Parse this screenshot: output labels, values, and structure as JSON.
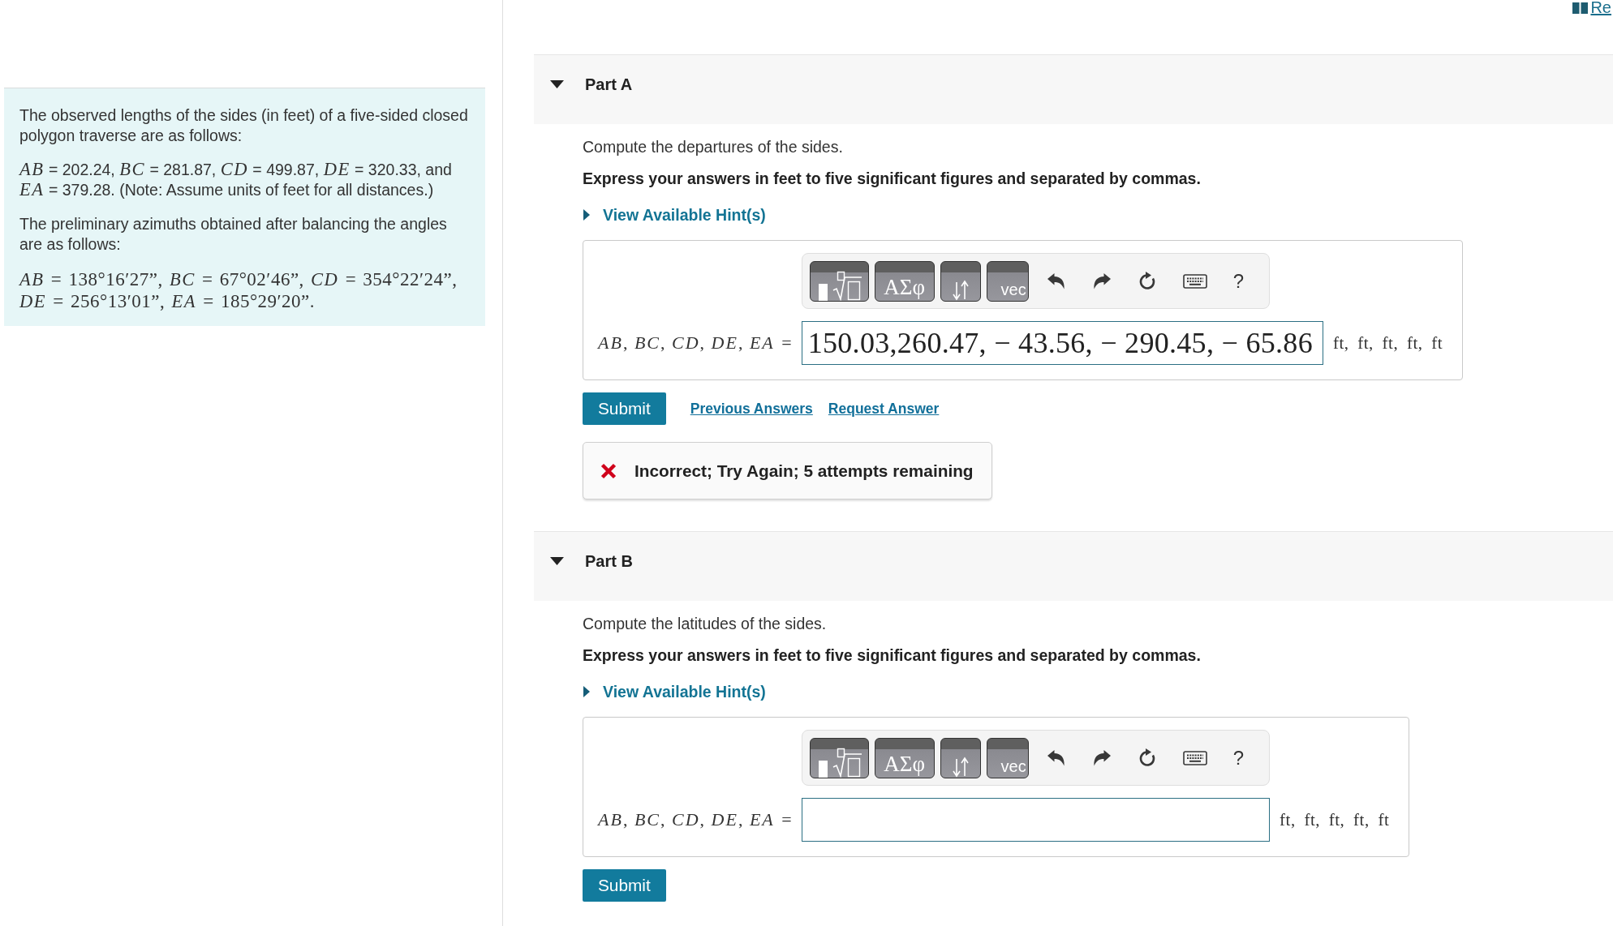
{
  "header": {
    "link": "Re"
  },
  "problem": {
    "paragraphs": [
      {
        "kind": "text",
        "text": "The observed lengths of the sides (in feet) of a five-sided closed polygon traverse are as follows:"
      },
      {
        "kind": "text",
        "text": "*AB* = 202.24, *BC* = 281.87, *CD* = 499.87, *DE* = 320.33, and *EA* = 379.28. (Note: Assume units of feet for all distances.)"
      },
      {
        "kind": "text",
        "text": "The preliminary azimuths obtained after balancing the angles are as follows:"
      },
      {
        "kind": "math",
        "text": "*AB* = 138°16′27”, *BC* = 67°02′46”, *CD* = 354°22′24”, *DE* = 256°13′01”, *EA* = 185°29′20”."
      }
    ]
  },
  "parts": [
    {
      "title": "Part A",
      "expanded": true,
      "prompt": "Compute the departures of the sides.",
      "instruction": "Express your answers in feet to five significant figures and separated by commas.",
      "hint": {
        "label": "View Available Hint(s)",
        "expanded": false
      },
      "toolbar": {
        "tiles": [
          {
            "kind": "templates"
          },
          {
            "kind": "symbols",
            "label": "ΑΣφ"
          },
          {
            "kind": "arrows"
          },
          {
            "kind": "vector",
            "label": "vec"
          }
        ],
        "actions": [
          {
            "kind": "undo"
          },
          {
            "kind": "redo"
          },
          {
            "kind": "reset"
          },
          {
            "kind": "keyboard"
          },
          {
            "kind": "help",
            "label": "?"
          }
        ]
      },
      "answer": {
        "label": "*AB*, *BC*, *CD*, *DE*, *EA* =",
        "value": "150.03,260.47, − 43.56, − 290.45, − 65.86",
        "units": "ft, ft, ft, ft, ft"
      },
      "submit": "Submit",
      "links": [
        "Previous Answers",
        "Request Answer"
      ],
      "feedback": {
        "correct": false,
        "text": "Incorrect; Try Again; 5 attempts remaining"
      }
    },
    {
      "title": "Part B",
      "expanded": true,
      "prompt": "Compute the latitudes of the sides.",
      "instruction": "Express your answers in feet to five significant figures and separated by commas.",
      "hint": {
        "label": "View Available Hint(s)",
        "expanded": false
      },
      "toolbar": {
        "tiles": [
          {
            "kind": "templates"
          },
          {
            "kind": "symbols",
            "label": "ΑΣφ"
          },
          {
            "kind": "arrows"
          },
          {
            "kind": "vector",
            "label": "vec"
          }
        ],
        "actions": [
          {
            "kind": "undo"
          },
          {
            "kind": "redo"
          },
          {
            "kind": "reset"
          },
          {
            "kind": "keyboard"
          },
          {
            "kind": "help",
            "label": "?"
          }
        ]
      },
      "answer": {
        "label": "*AB*, *BC*, *CD*, *DE*, *EA* =",
        "units": "ft, ft, ft, ft, ft"
      },
      "submit": "Submit"
    }
  ]
}
